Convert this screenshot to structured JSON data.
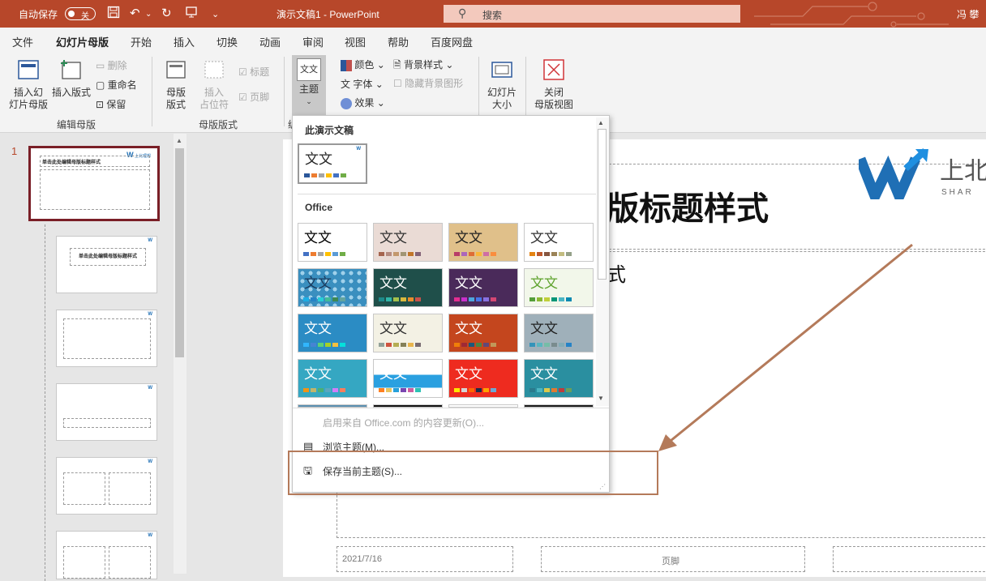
{
  "titlebar": {
    "autosave_label": "自动保存",
    "autosave_state": "关",
    "doc_title": "演示文稿1  -  PowerPoint",
    "search_placeholder": "搜索",
    "user_name": "冯 攀",
    "bg_color": "#b7472a"
  },
  "tabs": [
    "文件",
    "幻灯片母版",
    "开始",
    "插入",
    "切换",
    "动画",
    "审阅",
    "视图",
    "帮助",
    "百度网盘"
  ],
  "active_tab": "幻灯片母版",
  "ribbon": {
    "insert_master": "插入幻\n灯片母版",
    "insert_layout": "插入版式",
    "delete": "删除",
    "rename": "重命名",
    "preserve": "保留",
    "group_edit": "编辑母版",
    "master_layout": "母版\n版式",
    "insert_placeholder": "插入\n占位符",
    "title_check": "标题",
    "footer_check": "页脚",
    "group_layout": "母版版式",
    "themes": "主题",
    "group_edit_cut": "编",
    "colors": "颜色",
    "fonts": "字体",
    "effects": "效果",
    "background_styles": "背景样式",
    "hide_bg": "隐藏背景图形",
    "slide_size": "幻灯片\n大小",
    "close_master": "关闭\n母版视图"
  },
  "thumbnails": {
    "slide_number": "1",
    "master_title": "单击此处编辑母版标题样式",
    "layout_title": "单击此处编辑母版标题样式",
    "logo_text": "上北理想"
  },
  "slide": {
    "title_visible": "版标题样式",
    "subtitle_visible": "式",
    "logo_cn": "上北",
    "logo_en": "SHAR",
    "date": "2021/7/16",
    "footer": "页脚"
  },
  "themes_dropdown": {
    "this_presentation": "此演示文稿",
    "office": "Office",
    "theme_glyph": "文文",
    "enable_updates": "启用来自 Office.com 的内容更新(O)...",
    "browse": "浏览主题(M)...",
    "save_current": "保存当前主题(S)...",
    "themes": [
      {
        "bg": "#ffffff",
        "fg": "#000000"
      },
      {
        "bg": "#eadbd5",
        "fg": "#333333"
      },
      {
        "bg": "#e0c08a",
        "fg": "#222222"
      },
      {
        "bg": "#ffffff",
        "fg": "#333333"
      },
      {
        "bg": "#3a8fbf",
        "fg": "#1b3a5c"
      },
      {
        "bg": "#1f4f4a",
        "fg": "#ffffff"
      },
      {
        "bg": "#4a2a5a",
        "fg": "#ffffff"
      },
      {
        "bg": "#f2f7ea",
        "fg": "#5fa32e"
      },
      {
        "bg": "#2b8cc4",
        "fg": "#ffffff"
      },
      {
        "bg": "#f3f1e4",
        "fg": "#333333"
      },
      {
        "bg": "#c4461e",
        "fg": "#ffffff"
      },
      {
        "bg": "#9fb0ba",
        "fg": "#222222"
      },
      {
        "bg": "#35a7c2",
        "fg": "#ffffff"
      },
      {
        "bg": "#ffffff",
        "fg": "#ffffff"
      },
      {
        "bg": "#ee2b1f",
        "fg": "#ffffff"
      },
      {
        "bg": "#2a8fa0",
        "fg": "#ffffff"
      }
    ]
  },
  "highlight_color": "#b47a5a"
}
